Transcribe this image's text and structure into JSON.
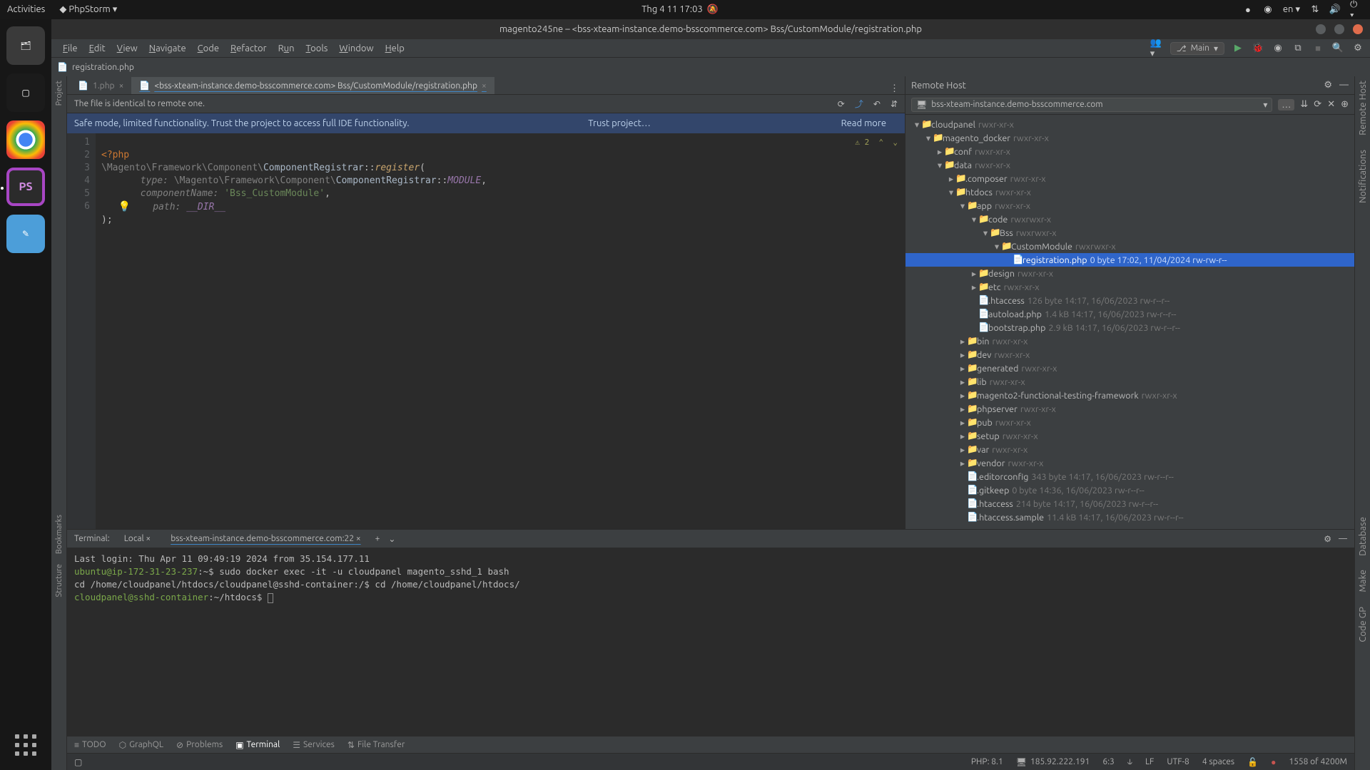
{
  "topbar": {
    "activities": "Activities",
    "app": "PhpStorm",
    "datetime": "Thg 4 11  17:03",
    "lang": "en"
  },
  "window": {
    "title": "magento245ne – <bss-xteam-instance.demo-bsscommerce.com> Bss/CustomModule/registration.php"
  },
  "menu": [
    "File",
    "Edit",
    "View",
    "Navigate",
    "Code",
    "Refactor",
    "Run",
    "Tools",
    "Window",
    "Help"
  ],
  "branch": "Main",
  "breadcrumb": "registration.php",
  "tabs": [
    {
      "label": "1.php",
      "active": false
    },
    {
      "label": "<bss-xteam-instance.demo-bsscommerce.com> Bss/CustomModule/registration.php",
      "active": true
    }
  ],
  "notice": "The file is identical to remote one.",
  "banner": {
    "text": "Safe mode, limited functionality. Trust the project to access full IDE functionality.",
    "trust": "Trust project…",
    "read": "Read more"
  },
  "editor_warn": "⚠ 2  ⌃  ⌄",
  "remote": {
    "title": "Remote Host",
    "combo": "bss-xteam-instance.demo-bsscommerce.com",
    "tree": [
      {
        "d": 0,
        "ar": "▾",
        "n": "cloudpanel",
        "m": "rwxr-xr-x"
      },
      {
        "d": 1,
        "ar": "▾",
        "n": "magento_docker",
        "m": "rwxr-xr-x"
      },
      {
        "d": 2,
        "ar": "▸",
        "n": "conf",
        "m": "rwxr-xr-x"
      },
      {
        "d": 2,
        "ar": "▾",
        "n": "data",
        "m": "rwxr-xr-x"
      },
      {
        "d": 3,
        "ar": "▸",
        "n": ".composer",
        "m": "rwxr-xr-x"
      },
      {
        "d": 3,
        "ar": "▾",
        "n": "htdocs",
        "m": "rwxr-xr-x"
      },
      {
        "d": 4,
        "ar": "▾",
        "n": "app",
        "m": "rwxr-xr-x"
      },
      {
        "d": 5,
        "ar": "▾",
        "n": "code",
        "m": "rwxrwxr-x"
      },
      {
        "d": 6,
        "ar": "▾",
        "n": "Bss",
        "m": "rwxrwxr-x"
      },
      {
        "d": 7,
        "ar": "▾",
        "n": "CustomModule",
        "m": "rwxrwxr-x"
      },
      {
        "d": 8,
        "ar": " ",
        "n": "registration.php",
        "m": "0 byte    17:02, 11/04/2024    rw-rw-r--",
        "sel": true,
        "file": true
      },
      {
        "d": 5,
        "ar": "▸",
        "n": "design",
        "m": "rwxr-xr-x"
      },
      {
        "d": 5,
        "ar": "▸",
        "n": "etc",
        "m": "rwxr-xr-x"
      },
      {
        "d": 5,
        "ar": " ",
        "n": ".htaccess",
        "m": "126 byte    14:17, 16/06/2023    rw-r--r--",
        "file": true
      },
      {
        "d": 5,
        "ar": " ",
        "n": "autoload.php",
        "m": "1.4 kB    14:17, 16/06/2023    rw-r--r--",
        "file": true
      },
      {
        "d": 5,
        "ar": " ",
        "n": "bootstrap.php",
        "m": "2.9 kB    14:17, 16/06/2023    rw-r--r--",
        "file": true
      },
      {
        "d": 4,
        "ar": "▸",
        "n": "bin",
        "m": "rwxr-xr-x"
      },
      {
        "d": 4,
        "ar": "▸",
        "n": "dev",
        "m": "rwxr-xr-x"
      },
      {
        "d": 4,
        "ar": "▸",
        "n": "generated",
        "m": "rwxr-xr-x"
      },
      {
        "d": 4,
        "ar": "▸",
        "n": "lib",
        "m": "rwxr-xr-x"
      },
      {
        "d": 4,
        "ar": "▸",
        "n": "magento2-functional-testing-framework",
        "m": "rwxr-xr-x"
      },
      {
        "d": 4,
        "ar": "▸",
        "n": "phpserver",
        "m": "rwxr-xr-x"
      },
      {
        "d": 4,
        "ar": "▸",
        "n": "pub",
        "m": "rwxr-xr-x"
      },
      {
        "d": 4,
        "ar": "▸",
        "n": "setup",
        "m": "rwxr-xr-x"
      },
      {
        "d": 4,
        "ar": "▸",
        "n": "var",
        "m": "rwxr-xr-x"
      },
      {
        "d": 4,
        "ar": "▸",
        "n": "vendor",
        "m": "rwxr-xr-x"
      },
      {
        "d": 4,
        "ar": " ",
        "n": ".editorconfig",
        "m": "343 byte    14:17, 16/06/2023    rw-r--r--",
        "file": true
      },
      {
        "d": 4,
        "ar": " ",
        "n": ".gitkeep",
        "m": "0 byte    14:36, 16/06/2023    rw-r--r--",
        "file": true
      },
      {
        "d": 4,
        "ar": " ",
        "n": ".htaccess",
        "m": "214 byte    14:17, 16/06/2023    rw-r--r--",
        "file": true
      },
      {
        "d": 4,
        "ar": " ",
        "n": ".htaccess.sample",
        "m": "11.4 kB    14:17, 16/06/2023    rw-r--r--",
        "file": true
      }
    ]
  },
  "terminal": {
    "label": "Terminal:",
    "tabs": [
      "Local",
      "bss-xteam-instance.demo-bsscommerce.com:22"
    ],
    "lines": [
      "Last login: Thu Apr 11 09:49:19 2024 from 35.154.177.11",
      "ubuntu@ip-172-31-23-237:~$ sudo docker exec -it -u cloudpanel magento_sshd_1 bash",
      "cd /home/cloudpanel/htdocs/cloudpanel@sshd-container:/$ cd /home/cloudpanel/htdocs/",
      "cloudpanel@sshd-container:~/htdocs$ "
    ]
  },
  "tools": [
    "TODO",
    "GraphQL",
    "Problems",
    "Terminal",
    "Services",
    "File Transfer"
  ],
  "status": {
    "php": "PHP: 8.1",
    "ip": "185.92.222.191",
    "n": "6:3",
    "lf": "LF",
    "enc": "UTF-8",
    "ind": "4 spaces",
    "mem": "1558 of 4200M"
  }
}
